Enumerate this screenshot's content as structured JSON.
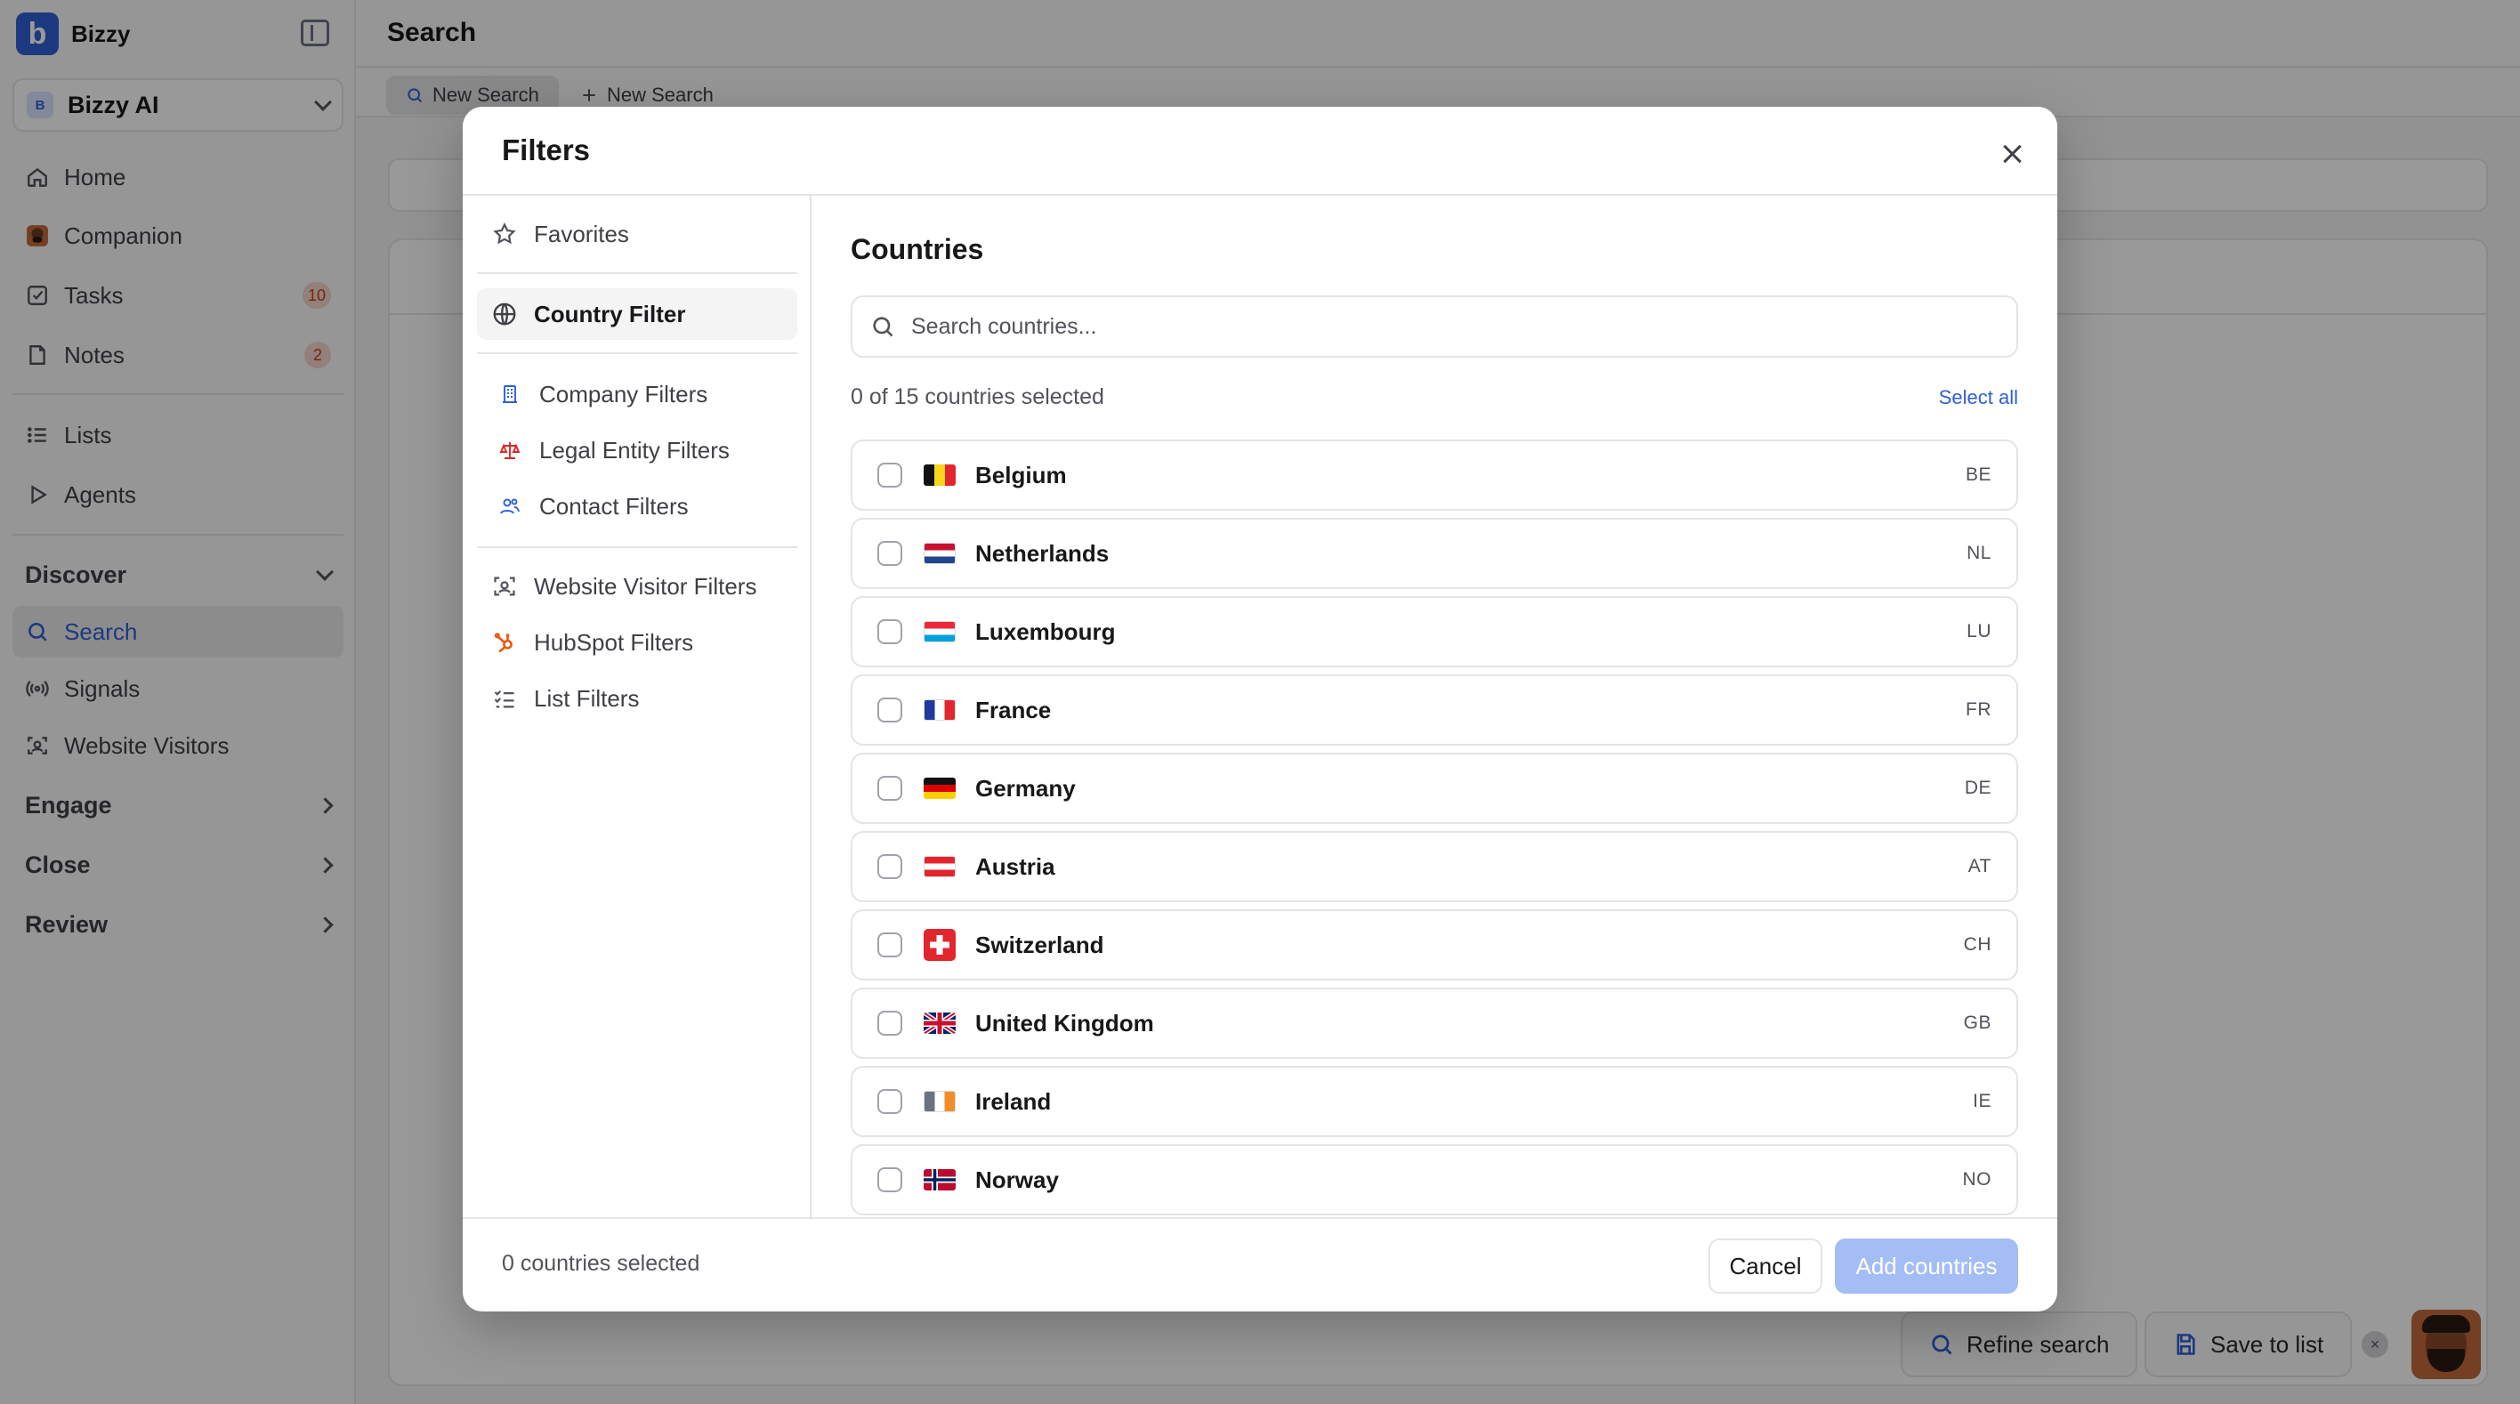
{
  "app": {
    "brand_name": "Bizzy",
    "brand_initial": "b",
    "workspace_badge": "B",
    "workspace_name": "Bizzy AI"
  },
  "sidebar": {
    "items": [
      {
        "label": "Home",
        "icon": "home-icon"
      },
      {
        "label": "Companion",
        "icon": "companion-avatar-icon"
      },
      {
        "label": "Tasks",
        "icon": "tasks-icon",
        "badge": "10"
      },
      {
        "label": "Notes",
        "icon": "notes-icon",
        "badge": "2"
      },
      {
        "label": "Lists",
        "icon": "list-icon"
      },
      {
        "label": "Agents",
        "icon": "play-icon"
      }
    ],
    "discover": {
      "label": "Discover",
      "items": [
        {
          "label": "Search",
          "icon": "search-icon",
          "active": true
        },
        {
          "label": "Signals",
          "icon": "signal-icon"
        },
        {
          "label": "Website Visitors",
          "icon": "visitor-icon"
        }
      ]
    },
    "sections": [
      "Engage",
      "Close",
      "Review"
    ]
  },
  "header": {
    "title": "Search",
    "tabs": [
      {
        "label": "New Search",
        "active": true
      },
      {
        "label": "New Search",
        "active": false
      }
    ]
  },
  "floating_actions": {
    "refine": "Refine search",
    "save": "Save to list",
    "close_glyph": "×"
  },
  "modal": {
    "title": "Filters",
    "nav": {
      "favorites": "Favorites",
      "country": "Country Filter",
      "company": "Company Filters",
      "legal": "Legal Entity Filters",
      "contact": "Contact Filters",
      "website_visitor": "Website Visitor Filters",
      "hubspot": "HubSpot Filters",
      "list": "List Filters"
    },
    "content": {
      "title": "Countries",
      "search_placeholder": "Search countries...",
      "selected_summary": "0 of 15 countries selected",
      "select_all": "Select all",
      "countries": [
        {
          "name": "Belgium",
          "code": "BE"
        },
        {
          "name": "Netherlands",
          "code": "NL"
        },
        {
          "name": "Luxembourg",
          "code": "LU"
        },
        {
          "name": "France",
          "code": "FR"
        },
        {
          "name": "Germany",
          "code": "DE"
        },
        {
          "name": "Austria",
          "code": "AT"
        },
        {
          "name": "Switzerland",
          "code": "CH"
        },
        {
          "name": "United Kingdom",
          "code": "GB"
        },
        {
          "name": "Ireland",
          "code": "IE"
        },
        {
          "name": "Norway",
          "code": "NO"
        }
      ]
    },
    "footer": {
      "selected_text": "0 countries selected",
      "cancel": "Cancel",
      "add": "Add countries"
    }
  },
  "colors": {
    "accent": "#2f5fd6",
    "add_button_disabled": "#a4bdf5",
    "badge_bg": "#f5d5cc",
    "badge_text": "#c2410c"
  }
}
